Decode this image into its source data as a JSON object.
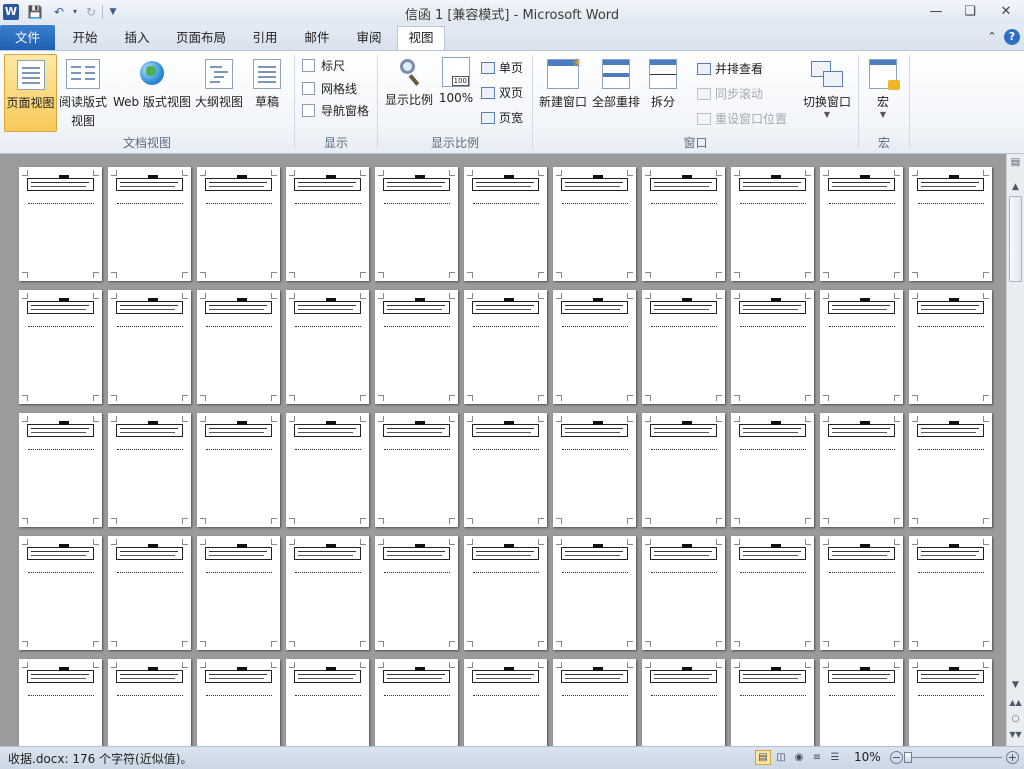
{
  "titlebar": {
    "app_icon": "word-icon",
    "title": "信函 1 [兼容模式] - Microsoft Word",
    "quick_access": [
      "save-icon",
      "undo-icon",
      "redo-icon",
      "customize-icon"
    ]
  },
  "tabs": [
    {
      "label": "文件"
    },
    {
      "label": "开始"
    },
    {
      "label": "插入"
    },
    {
      "label": "页面布局"
    },
    {
      "label": "引用"
    },
    {
      "label": "邮件"
    },
    {
      "label": "审阅"
    },
    {
      "label": "视图"
    }
  ],
  "ribbon": {
    "doc_views": {
      "label": "文档视图",
      "print_layout": "页面视图",
      "full_screen_1": "阅读版式",
      "full_screen_2": "视图",
      "web_layout": "Web 版式视图",
      "outline": "大纲视图",
      "draft": "草稿"
    },
    "show": {
      "label": "显示",
      "ruler": "标尺",
      "gridlines": "网格线",
      "nav_pane": "导航窗格"
    },
    "zoom": {
      "label": "显示比例",
      "zoom": "显示比例",
      "hundred": "100%",
      "one_page": "单页",
      "two_pages": "双页",
      "page_width": "页宽"
    },
    "window": {
      "label": "窗口",
      "new_window": "新建窗口",
      "arrange_all": "全部重排",
      "split": "拆分",
      "side_by_side": "并排查看",
      "sync_scroll": "同步滚动",
      "reset_position": "重设窗口位置",
      "switch_windows": "切换窗口"
    },
    "macros": {
      "label": "宏",
      "macros": "宏"
    }
  },
  "document": {
    "rows": 5,
    "columns": 11
  },
  "statusbar": {
    "info": "收据.docx: 176 个字符(近似值)。",
    "zoom": "10%"
  }
}
